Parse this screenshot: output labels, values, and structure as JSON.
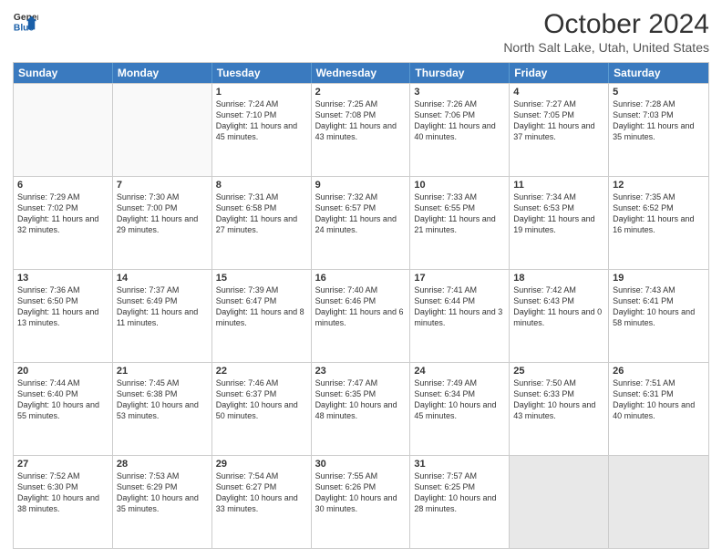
{
  "header": {
    "logo_line1": "General",
    "logo_line2": "Blue",
    "main_title": "October 2024",
    "subtitle": "North Salt Lake, Utah, United States"
  },
  "days": [
    "Sunday",
    "Monday",
    "Tuesday",
    "Wednesday",
    "Thursday",
    "Friday",
    "Saturday"
  ],
  "rows": [
    [
      {
        "day": "",
        "text": "",
        "empty": true
      },
      {
        "day": "",
        "text": "",
        "empty": true
      },
      {
        "day": "1",
        "text": "Sunrise: 7:24 AM\nSunset: 7:10 PM\nDaylight: 11 hours and 45 minutes."
      },
      {
        "day": "2",
        "text": "Sunrise: 7:25 AM\nSunset: 7:08 PM\nDaylight: 11 hours and 43 minutes."
      },
      {
        "day": "3",
        "text": "Sunrise: 7:26 AM\nSunset: 7:06 PM\nDaylight: 11 hours and 40 minutes."
      },
      {
        "day": "4",
        "text": "Sunrise: 7:27 AM\nSunset: 7:05 PM\nDaylight: 11 hours and 37 minutes."
      },
      {
        "day": "5",
        "text": "Sunrise: 7:28 AM\nSunset: 7:03 PM\nDaylight: 11 hours and 35 minutes."
      }
    ],
    [
      {
        "day": "6",
        "text": "Sunrise: 7:29 AM\nSunset: 7:02 PM\nDaylight: 11 hours and 32 minutes."
      },
      {
        "day": "7",
        "text": "Sunrise: 7:30 AM\nSunset: 7:00 PM\nDaylight: 11 hours and 29 minutes."
      },
      {
        "day": "8",
        "text": "Sunrise: 7:31 AM\nSunset: 6:58 PM\nDaylight: 11 hours and 27 minutes."
      },
      {
        "day": "9",
        "text": "Sunrise: 7:32 AM\nSunset: 6:57 PM\nDaylight: 11 hours and 24 minutes."
      },
      {
        "day": "10",
        "text": "Sunrise: 7:33 AM\nSunset: 6:55 PM\nDaylight: 11 hours and 21 minutes."
      },
      {
        "day": "11",
        "text": "Sunrise: 7:34 AM\nSunset: 6:53 PM\nDaylight: 11 hours and 19 minutes."
      },
      {
        "day": "12",
        "text": "Sunrise: 7:35 AM\nSunset: 6:52 PM\nDaylight: 11 hours and 16 minutes."
      }
    ],
    [
      {
        "day": "13",
        "text": "Sunrise: 7:36 AM\nSunset: 6:50 PM\nDaylight: 11 hours and 13 minutes."
      },
      {
        "day": "14",
        "text": "Sunrise: 7:37 AM\nSunset: 6:49 PM\nDaylight: 11 hours and 11 minutes."
      },
      {
        "day": "15",
        "text": "Sunrise: 7:39 AM\nSunset: 6:47 PM\nDaylight: 11 hours and 8 minutes."
      },
      {
        "day": "16",
        "text": "Sunrise: 7:40 AM\nSunset: 6:46 PM\nDaylight: 11 hours and 6 minutes."
      },
      {
        "day": "17",
        "text": "Sunrise: 7:41 AM\nSunset: 6:44 PM\nDaylight: 11 hours and 3 minutes."
      },
      {
        "day": "18",
        "text": "Sunrise: 7:42 AM\nSunset: 6:43 PM\nDaylight: 11 hours and 0 minutes."
      },
      {
        "day": "19",
        "text": "Sunrise: 7:43 AM\nSunset: 6:41 PM\nDaylight: 10 hours and 58 minutes."
      }
    ],
    [
      {
        "day": "20",
        "text": "Sunrise: 7:44 AM\nSunset: 6:40 PM\nDaylight: 10 hours and 55 minutes."
      },
      {
        "day": "21",
        "text": "Sunrise: 7:45 AM\nSunset: 6:38 PM\nDaylight: 10 hours and 53 minutes."
      },
      {
        "day": "22",
        "text": "Sunrise: 7:46 AM\nSunset: 6:37 PM\nDaylight: 10 hours and 50 minutes."
      },
      {
        "day": "23",
        "text": "Sunrise: 7:47 AM\nSunset: 6:35 PM\nDaylight: 10 hours and 48 minutes."
      },
      {
        "day": "24",
        "text": "Sunrise: 7:49 AM\nSunset: 6:34 PM\nDaylight: 10 hours and 45 minutes."
      },
      {
        "day": "25",
        "text": "Sunrise: 7:50 AM\nSunset: 6:33 PM\nDaylight: 10 hours and 43 minutes."
      },
      {
        "day": "26",
        "text": "Sunrise: 7:51 AM\nSunset: 6:31 PM\nDaylight: 10 hours and 40 minutes."
      }
    ],
    [
      {
        "day": "27",
        "text": "Sunrise: 7:52 AM\nSunset: 6:30 PM\nDaylight: 10 hours and 38 minutes."
      },
      {
        "day": "28",
        "text": "Sunrise: 7:53 AM\nSunset: 6:29 PM\nDaylight: 10 hours and 35 minutes."
      },
      {
        "day": "29",
        "text": "Sunrise: 7:54 AM\nSunset: 6:27 PM\nDaylight: 10 hours and 33 minutes."
      },
      {
        "day": "30",
        "text": "Sunrise: 7:55 AM\nSunset: 6:26 PM\nDaylight: 10 hours and 30 minutes."
      },
      {
        "day": "31",
        "text": "Sunrise: 7:57 AM\nSunset: 6:25 PM\nDaylight: 10 hours and 28 minutes."
      },
      {
        "day": "",
        "text": "",
        "empty": true,
        "shaded": true
      },
      {
        "day": "",
        "text": "",
        "empty": true,
        "shaded": true
      }
    ]
  ]
}
